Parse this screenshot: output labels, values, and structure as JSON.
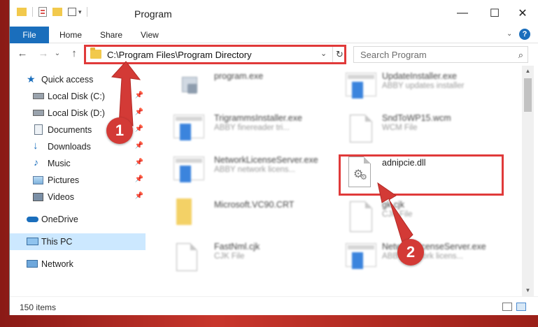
{
  "window": {
    "title": "Program",
    "controls": {
      "minimize": "—",
      "maximize": "☐",
      "close": "✕"
    }
  },
  "ribbon": {
    "tabs": [
      "File",
      "Home",
      "Share",
      "View"
    ],
    "help_icon": "?"
  },
  "navigation": {
    "back": "←",
    "forward": "→",
    "recent": "⌄",
    "up": "↑",
    "address": "C:\\Program Files\\Program Directory",
    "dropdown": "⌄",
    "refresh": "↻",
    "search_placeholder": "Search Program",
    "search_icon": "⌕"
  },
  "sidebar": {
    "items": [
      {
        "label": "Quick access",
        "icon": "star-icon",
        "pinned": false
      },
      {
        "label": "Local Disk (C:)",
        "icon": "drive-icon",
        "pinned": true
      },
      {
        "label": "Local Disk (D:)",
        "icon": "drive-icon",
        "pinned": true
      },
      {
        "label": "Documents",
        "icon": "documents-icon",
        "pinned": true
      },
      {
        "label": "Downloads",
        "icon": "download-icon",
        "pinned": true
      },
      {
        "label": "Music",
        "icon": "music-icon",
        "pinned": true
      },
      {
        "label": "Pictures",
        "icon": "pictures-icon",
        "pinned": true
      },
      {
        "label": "Videos",
        "icon": "videos-icon",
        "pinned": true
      },
      {
        "label": "OneDrive",
        "icon": "cloud-icon",
        "pinned": false
      },
      {
        "label": "This PC",
        "icon": "computer-icon",
        "pinned": false,
        "selected": true
      },
      {
        "label": "Network",
        "icon": "network-icon",
        "pinned": false
      }
    ],
    "pin_glyph": "📌"
  },
  "files": [
    {
      "name": "program.exe",
      "desc": "",
      "type": "app"
    },
    {
      "name": "UpdateInstaller.exe",
      "desc": "ABBY updates installer",
      "type": "app"
    },
    {
      "name": "TrigrammsInstaller.exe",
      "desc": "ABBY finereader tri...",
      "type": "app"
    },
    {
      "name": "SndToWP15.wcm",
      "desc": "WCM File",
      "type": "doc"
    },
    {
      "name": "NetworkLicenseServer.exe",
      "desc": "ABBY network licens...",
      "type": "app"
    },
    {
      "name": "adnipcie.dll",
      "desc": "",
      "type": "dll",
      "highlighted": true
    },
    {
      "name": "Microsoft.VC90.CRT",
      "desc": "",
      "type": "folder"
    },
    {
      "name": "gk.cjk",
      "desc": "CJK File",
      "type": "doc"
    },
    {
      "name": "FastNml.cjk",
      "desc": "CJK File",
      "type": "doc"
    },
    {
      "name": "NetworkLicenseServer.exe",
      "desc": "ABBY network licens...",
      "type": "app"
    }
  ],
  "status": {
    "item_count": "150 items"
  },
  "annotations": {
    "step1": "1",
    "step2": "2",
    "color": "#d33a36"
  }
}
